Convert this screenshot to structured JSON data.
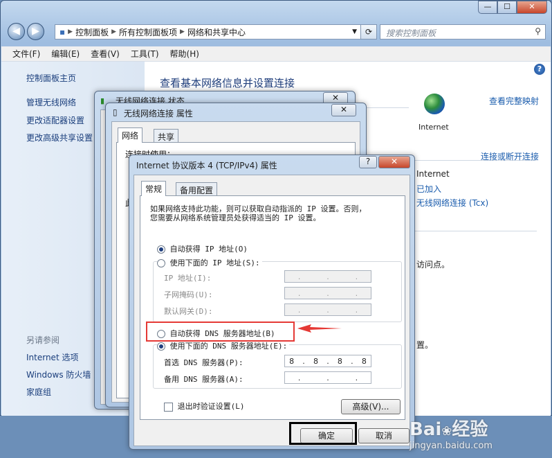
{
  "window": {
    "min": "—",
    "max": "☐",
    "close": "✕"
  },
  "address": {
    "crumbs": [
      "控制面板",
      "所有控制面板项",
      "网络和共享中心"
    ],
    "search_placeholder": "搜索控制面板"
  },
  "menu": [
    "文件(F)",
    "编辑(E)",
    "查看(V)",
    "工具(T)",
    "帮助(H)"
  ],
  "left_nav": {
    "home": "控制面板主页",
    "links": [
      "管理无线网络",
      "更改适配器设置",
      "更改高级共享设置"
    ],
    "see_also": "另请参阅",
    "see_also_links": [
      "Internet 选项",
      "Windows 防火墙",
      "家庭组"
    ]
  },
  "right": {
    "title": "查看基本网络信息并设置连接",
    "view_full_map": "查看完整映射",
    "internet_label": "Internet",
    "connect_disconnect": "连接或断开连接",
    "internet_access": "Internet",
    "joined": "已加入",
    "wireless_conn": "无线网络连接 (Tcx)",
    "access_point_frag": "访问点。",
    "period_frag": "置。"
  },
  "status_dialog": {
    "title": "无线网络连接 状态"
  },
  "props_dialog": {
    "title": "无线网络连接 属性",
    "tabs": [
      "网络",
      "共享"
    ],
    "frag1": "连接时使用：",
    "frag2": "此"
  },
  "ipv4_dialog": {
    "title": "Internet 协议版本 4 (TCP/IPv4) 属性",
    "help": "?",
    "tabs": [
      "常规",
      "备用配置"
    ],
    "description_line1": "如果网络支持此功能，则可以获取自动指派的 IP 设置。否则，",
    "description_line2": "您需要从网络系统管理员处获得适当的 IP 设置。",
    "ip_auto": "自动获得 IP 地址(O)",
    "ip_manual": "使用下面的 IP 地址(S):",
    "ip_address": "IP 地址(I):",
    "subnet": "子网掩码(U):",
    "gateway": "默认网关(D):",
    "dns_auto": "自动获得 DNS 服务器地址(B)",
    "dns_manual": "使用下面的 DNS 服务器地址(E):",
    "dns_pref": "首选 DNS 服务器(P):",
    "dns_alt": "备用 DNS 服务器(A):",
    "dns_pref_value": [
      "8",
      "8",
      "8",
      "8"
    ],
    "validate": "退出时验证设置(L)",
    "advanced": "高级(V)...",
    "ok": "确定",
    "cancel": "取消"
  },
  "watermark": {
    "brand": "Bai",
    "brand2": "经验",
    "url": "jingyan.baidu.com"
  },
  "colors": {
    "highlight_box": "#e53935",
    "ok_box": "#000000",
    "arrow": "#e53935"
  }
}
